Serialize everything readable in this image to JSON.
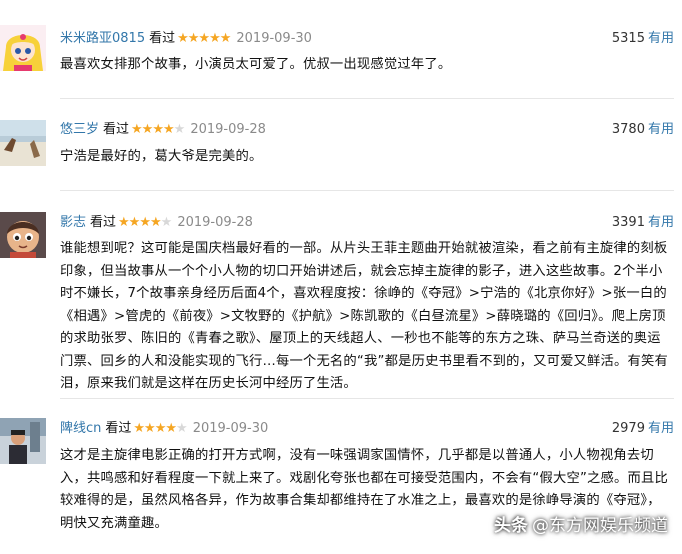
{
  "reviews": [
    {
      "author": "米米路亚0815",
      "seen": "看过",
      "rating": 5,
      "date": "2019-09-30",
      "votes": "5315",
      "useful": "有用",
      "text": "最喜欢女排那个故事，小演员太可爱了。优叔一出现感觉过年了。"
    },
    {
      "author": "悠三岁",
      "seen": "看过",
      "rating": 4,
      "date": "2019-09-28",
      "votes": "3780",
      "useful": "有用",
      "text": "宁浩是最好的，葛大爷是完美的。"
    },
    {
      "author": "影志",
      "seen": "看过",
      "rating": 4,
      "date": "2019-09-28",
      "votes": "3391",
      "useful": "有用",
      "text": "谁能想到呢？这可能是国庆档最好看的一部。从片头王菲主题曲开始就被渲染，看之前有主旋律的刻板印象，但当故事从一个个小人物的切口开始讲述后，就会忘掉主旋律的影子，进入这些故事。2个半小时不嫌长，7个故事亲身经历后面4个，喜欢程度按：徐峥的《夺冠》>宁浩的《北京你好》>张一白的《相遇》>管虎的《前夜》>文牧野的《护航》>陈凯歌的《白昼流星》>薛晓璐的《回归》。爬上房顶的求助张罗、陈旧的《青春之歌》、屋顶上的天线超人、一秒也不能等的东方之珠、萨马兰奇送的奥运门票、回乡的人和没能实现的飞行…每一个无名的“我”都是历史书里看不到的，又可爱又鲜活。有笑有泪，原来我们就是这样在历史长河中经历了生活。"
    },
    {
      "author": "陴线cn",
      "seen": "看过",
      "rating": 4,
      "date": "2019-09-30",
      "votes": "2979",
      "useful": "有用",
      "text": "这才是主旋律电影正确的打开方式啊，没有一味强调家国情怀，几乎都是以普通人，小人物视角去切入，共鸣感和好看程度一下就上来了。戏剧化夸张也都在可接受范围内，不会有“假大空”之感。而且比较难得的是，虽然风格各异，作为故事合集却都维持在了水准之上，最喜欢的是徐峥导演的《夺冠》，明快又充满童趣。"
    }
  ],
  "watermark": {
    "platform": "头条",
    "source": "@东方网娱乐频道"
  },
  "colors": {
    "link": "#3377aa",
    "star": "#f5a623",
    "date": "#8a8a8a"
  }
}
